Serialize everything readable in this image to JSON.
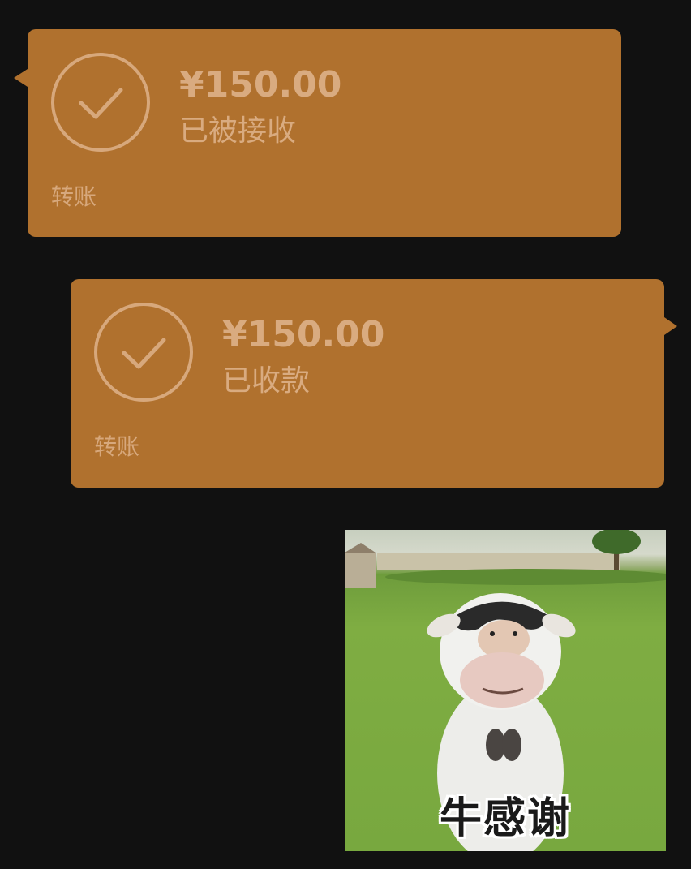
{
  "messages": [
    {
      "direction": "incoming",
      "amount": "¥150.00",
      "status": "已被接收",
      "label": "转账",
      "icon": "check-circle-icon"
    },
    {
      "direction": "outgoing",
      "amount": "¥150.00",
      "status": "已收款",
      "label": "转账",
      "icon": "check-circle-icon"
    }
  ],
  "sticker": {
    "caption": "牛感谢",
    "description_icon": "cow-sticker-image"
  },
  "colors": {
    "background": "#111111",
    "transfer_bubble": "#B0712E",
    "transfer_text": "#D9AB80"
  }
}
